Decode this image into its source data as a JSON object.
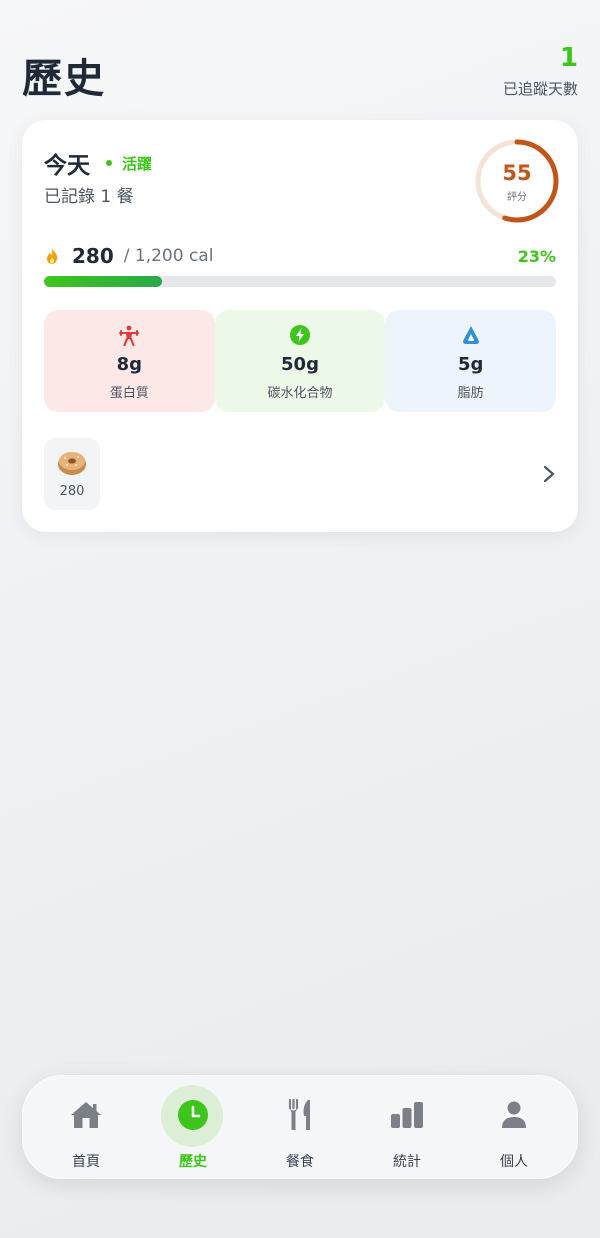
{
  "header": {
    "title": "歷史",
    "days_count": "1",
    "days_label": "已追蹤天數"
  },
  "day_card": {
    "title": "今天",
    "status": "活躍",
    "meals_logged": "已記錄 1 餐",
    "score": {
      "value": "55",
      "label": "評分",
      "fraction": 0.55
    },
    "calories": {
      "value": "280",
      "goal": "/ 1,200 cal",
      "percent_label": "23%",
      "fraction": 0.23
    },
    "macros": [
      {
        "value": "8g",
        "label": "蛋白質",
        "icon": "weightlifter-icon"
      },
      {
        "value": "50g",
        "label": "碳水化合物",
        "icon": "lightning-icon"
      },
      {
        "value": "5g",
        "label": "脂肪",
        "icon": "droplet-icon"
      }
    ],
    "meals": [
      {
        "icon": "bagel-icon",
        "calories": "280"
      }
    ]
  },
  "colors": {
    "accent": "#3ec51c",
    "score": "#c2561a",
    "protein_bg": "#fde8e8",
    "carbs_bg": "#edf9e8",
    "fat_bg": "#edf4fc"
  },
  "tabbar": {
    "items": [
      {
        "label": "首頁",
        "icon": "home-icon",
        "active": false
      },
      {
        "label": "歷史",
        "icon": "clock-icon",
        "active": true
      },
      {
        "label": "餐食",
        "icon": "fork-knife-icon",
        "active": false
      },
      {
        "label": "統計",
        "icon": "bar-chart-icon",
        "active": false
      },
      {
        "label": "個人",
        "icon": "person-icon",
        "active": false
      }
    ]
  }
}
